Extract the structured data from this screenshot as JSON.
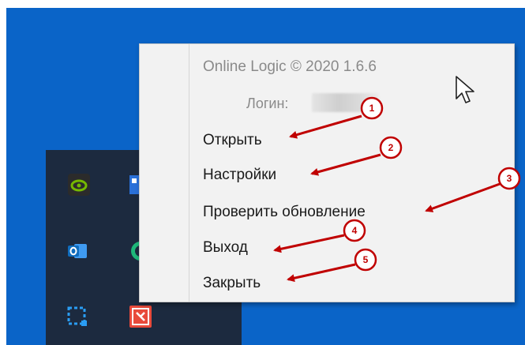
{
  "menu": {
    "header": "Online Logic © 2020 1.6.6",
    "login_label": "Логин:",
    "items": [
      {
        "label": "Открыть",
        "badge": "1"
      },
      {
        "label": "Настройки",
        "badge": "2"
      },
      {
        "label": "Проверить обновление",
        "badge": "3"
      },
      {
        "label": "Выход",
        "badge": "4"
      },
      {
        "label": "Закрыть",
        "badge": "5"
      }
    ]
  },
  "tray_icons": [
    "nvidia-icon",
    "windows-app-icon",
    "outlook-icon",
    "green-app-icon",
    "snipping-tool-icon",
    "red-app-icon"
  ],
  "colors": {
    "desktop": "#0a64c8",
    "taskbar": "#1c2a3f",
    "menu_bg": "#f2f2f2",
    "annotation": "#c00000"
  }
}
